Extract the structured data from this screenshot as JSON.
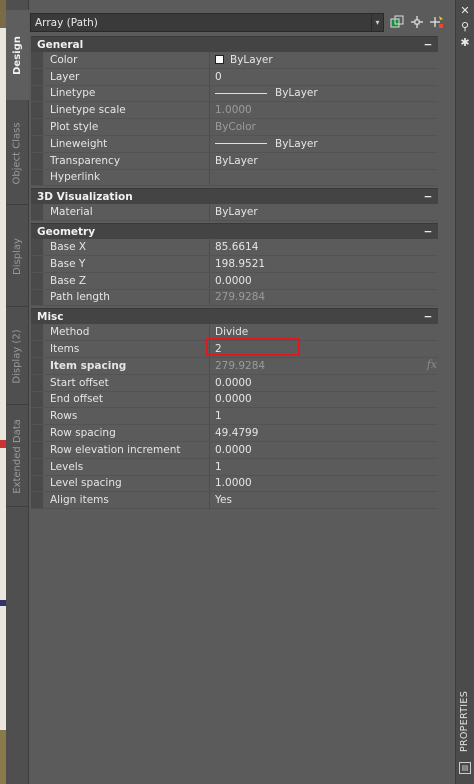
{
  "selector": {
    "value": "Array (Path)",
    "icons": [
      "toggle-pickadd-icon",
      "select-objects-icon",
      "quick-select-icon"
    ]
  },
  "left_tabs": [
    "Design",
    "Object Class",
    "Display",
    "Display (2)",
    "Extended Data"
  ],
  "right_panel": {
    "close_glyph": "✕",
    "pin_glyph": "⚲",
    "settings_glyph": "✱",
    "label": "PROPERTIES",
    "menu_glyph": "▤"
  },
  "collapse_glyph": "−",
  "categories": {
    "general": {
      "title": "General",
      "rows": [
        {
          "name": "Color",
          "value": "ByLayer"
        },
        {
          "name": "Layer",
          "value": "0"
        },
        {
          "name": "Linetype",
          "value": "ByLayer"
        },
        {
          "name": "Linetype scale",
          "value": "1.0000"
        },
        {
          "name": "Plot style",
          "value": "ByColor"
        },
        {
          "name": "Lineweight",
          "value": "ByLayer"
        },
        {
          "name": "Transparency",
          "value": "ByLayer"
        },
        {
          "name": "Hyperlink",
          "value": ""
        }
      ]
    },
    "visualization": {
      "title": "3D Visualization",
      "rows": [
        {
          "name": "Material",
          "value": "ByLayer"
        }
      ]
    },
    "geometry": {
      "title": "Geometry",
      "rows": [
        {
          "name": "Base X",
          "value": "85.6614"
        },
        {
          "name": "Base Y",
          "value": "198.9521"
        },
        {
          "name": "Base Z",
          "value": "0.0000"
        },
        {
          "name": "Path length",
          "value": "279.9284"
        }
      ]
    },
    "misc": {
      "title": "Misc",
      "rows": [
        {
          "name": "Method",
          "value": "Divide"
        },
        {
          "name": "Items",
          "value": "2"
        },
        {
          "name": "Item spacing",
          "value": "279.9284"
        },
        {
          "name": "Start offset",
          "value": "0.0000"
        },
        {
          "name": "End offset",
          "value": "0.0000"
        },
        {
          "name": "Rows",
          "value": "1"
        },
        {
          "name": "Row spacing",
          "value": "49.4799"
        },
        {
          "name": "Row elevation increment",
          "value": "0.0000"
        },
        {
          "name": "Levels",
          "value": "1"
        },
        {
          "name": "Level spacing",
          "value": "1.0000"
        },
        {
          "name": "Align items",
          "value": "Yes"
        }
      ]
    }
  },
  "fx_label": "fx",
  "colors": {
    "panel_bg": "#5b5b5b",
    "category_bg": "#444444",
    "highlight_border": "#e0191f"
  }
}
